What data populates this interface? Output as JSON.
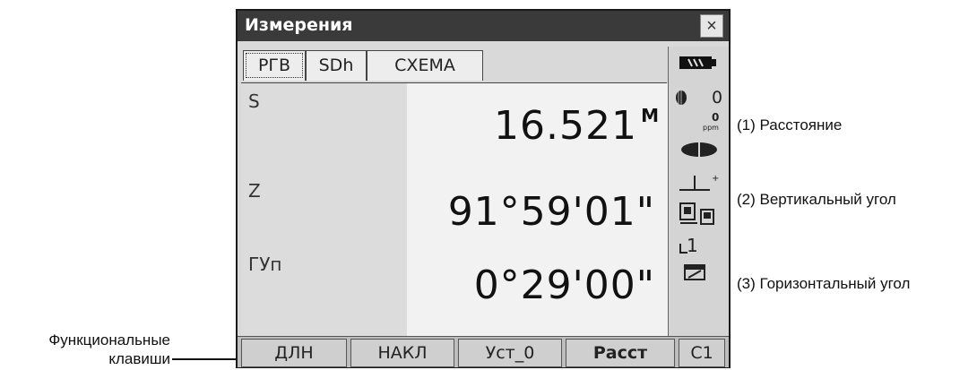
{
  "window": {
    "title": "Измерения",
    "close_symbol": "×"
  },
  "tabs": [
    {
      "label": "РГВ",
      "active": true
    },
    {
      "label": "SDh",
      "active": false
    },
    {
      "label": "СХЕМА",
      "active": false
    }
  ],
  "measurements": [
    {
      "label": "S",
      "value": "16.521",
      "unit": "M"
    },
    {
      "label": "Z",
      "value": "91°59'01\""
    },
    {
      "label": "ГУп",
      "value": "0°29'00\""
    }
  ],
  "status": {
    "prism_constant": "0",
    "ppm_value": "0",
    "ppm_unit": "ppm",
    "channel": "1"
  },
  "function_keys": [
    {
      "label": "ДЛН",
      "bold": false
    },
    {
      "label": "НАКЛ",
      "bold": false
    },
    {
      "label": "Уст_0",
      "bold": false
    },
    {
      "label": "Расст",
      "bold": true
    },
    {
      "label": "C1",
      "bold": false
    }
  ],
  "annotations": {
    "distance": "(1) Расстояние",
    "vertical": "(2) Вертикальный угол",
    "horizontal": "(3) Горизонтальный угол",
    "fn_line1": "Функциональные",
    "fn_line2": "клавиши"
  },
  "colors": {
    "titlebar": "#3a3a3a",
    "screen_bg": "#d9d9d9",
    "value_bg": "#f2f2f2"
  }
}
